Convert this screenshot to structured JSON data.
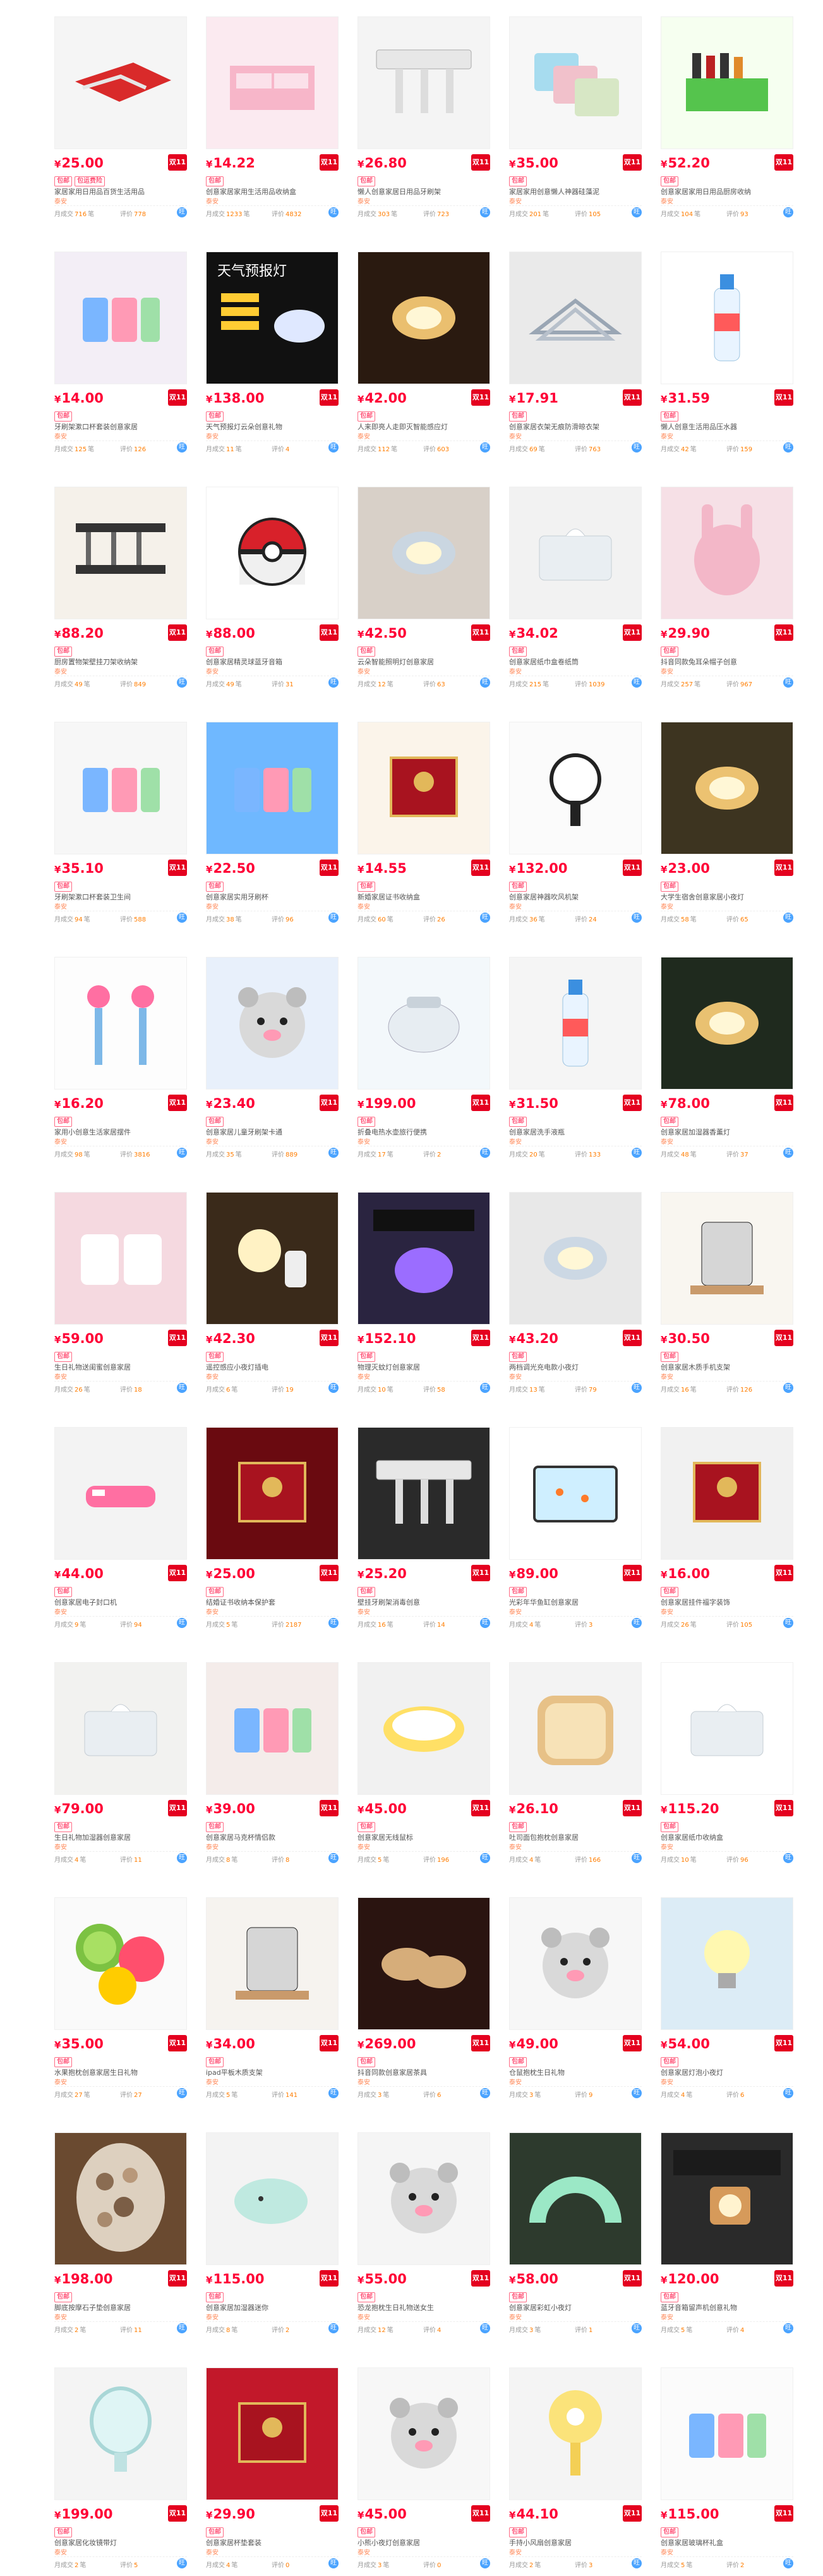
{
  "labels": {
    "sales_prefix": "月成交",
    "sales_unit": "笔",
    "reviews_prefix": "评价",
    "double11": "双11",
    "wangwang": "旺"
  },
  "colors": {
    "price": "#ff0036",
    "tag": "#ff0036",
    "badge": "#e4001f"
  },
  "products": [
    {
      "price": "25.00",
      "tags": [
        "包邮",
        "包运费险"
      ],
      "title": "家居家用日用品百货生活用品",
      "shop": "泰安",
      "sales": "716",
      "reviews": "778",
      "bg": "#f5f5f5",
      "art": "slicer"
    },
    {
      "price": "14.22",
      "tags": [
        "包邮"
      ],
      "title": "创意家居家用生活用品收纳盒",
      "shop": "泰安",
      "sales": "1233",
      "reviews": "4832",
      "bg": "#fbeaf0",
      "art": "organizer"
    },
    {
      "price": "26.80",
      "tags": [
        "包邮"
      ],
      "title": "懒人创意家居日用品牙刷架",
      "shop": "泰安",
      "sales": "303",
      "reviews": "723",
      "bg": "#f4f4f4",
      "art": "toothbrush"
    },
    {
      "price": "35.00",
      "tags": [
        "包邮"
      ],
      "title": "家居家用创意懒人神器硅藻泥",
      "shop": "泰安",
      "sales": "201",
      "reviews": "105",
      "bg": "#f7f7f7",
      "art": "mat"
    },
    {
      "price": "52.20",
      "tags": [
        "包邮"
      ],
      "title": "创意家居家用日用品厨房收纳",
      "shop": "泰安",
      "sales": "104",
      "reviews": "93",
      "bg": "#f6fff0",
      "art": "spicebox"
    },
    {
      "price": "14.00",
      "tags": [
        "包邮"
      ],
      "title": "牙刷架漱口杯套装创意家居",
      "shop": "泰安",
      "sales": "125",
      "reviews": "126",
      "bg": "#f3eef6",
      "art": "cups"
    },
    {
      "price": "138.00",
      "tags": [
        "包邮"
      ],
      "title": "天气预报灯云朵创意礼物",
      "shop": "泰安",
      "sales": "11",
      "reviews": "4",
      "bg": "#111111",
      "art": "weatherlamp"
    },
    {
      "price": "42.00",
      "tags": [
        "包邮"
      ],
      "title": "人来即亮人走即灭智能感应灯",
      "shop": "泰安",
      "sales": "112",
      "reviews": "603",
      "bg": "#2a1a10",
      "art": "sensorlamp"
    },
    {
      "price": "17.91",
      "tags": [
        "包邮"
      ],
      "title": "创意家居衣架无痕防滑晾衣架",
      "shop": "泰安",
      "sales": "69",
      "reviews": "763",
      "bg": "#eaeaea",
      "art": "hangers"
    },
    {
      "price": "31.59",
      "tags": [
        "包邮"
      ],
      "title": "懒人创意生活用品压水器",
      "shop": "泰安",
      "sales": "42",
      "reviews": "159",
      "bg": "#ffffff",
      "art": "bottle"
    },
    {
      "price": "88.20",
      "tags": [
        "包邮"
      ],
      "title": "厨房置物架壁挂刀架收纳架",
      "shop": "泰安",
      "sales": "49",
      "reviews": "849",
      "bg": "#f5f1ea",
      "art": "rack"
    },
    {
      "price": "88.00",
      "tags": [
        "包邮"
      ],
      "title": "创意家居精灵球蓝牙音箱",
      "shop": "泰安",
      "sales": "49",
      "reviews": "31",
      "bg": "#ffffff",
      "art": "pokeball"
    },
    {
      "price": "42.50",
      "tags": [
        "包邮"
      ],
      "title": "云朵智能照明灯创意家居",
      "shop": "泰安",
      "sales": "12",
      "reviews": "63",
      "bg": "#d8d0c8",
      "art": "cloudlamp"
    },
    {
      "price": "34.02",
      "tags": [
        "包邮"
      ],
      "title": "创意家居纸巾盒卷纸筒",
      "shop": "泰安",
      "sales": "215",
      "reviews": "1039",
      "bg": "#f2f2f2",
      "art": "tissue"
    },
    {
      "price": "29.90",
      "tags": [
        "包邮"
      ],
      "title": "抖音同款兔耳朵帽子创意",
      "shop": "泰安",
      "sales": "257",
      "reviews": "967",
      "bg": "#f6e0e6",
      "art": "hat"
    },
    {
      "price": "35.10",
      "tags": [
        "包邮"
      ],
      "title": "牙刷架漱口杯套装卫生间",
      "shop": "泰安",
      "sales": "94",
      "reviews": "588",
      "bg": "#f7f7f7",
      "art": "cups2"
    },
    {
      "price": "22.50",
      "tags": [
        "包邮"
      ],
      "title": "创意家居实用牙刷杯",
      "shop": "泰安",
      "sales": "38",
      "reviews": "96",
      "bg": "#6fb8ff",
      "art": "cups3"
    },
    {
      "price": "14.55",
      "tags": [
        "包邮"
      ],
      "title": "新婚家居证书收纳盒",
      "shop": "泰安",
      "sales": "60",
      "reviews": "26",
      "bg": "#fbf4ea",
      "art": "redbox"
    },
    {
      "price": "132.00",
      "tags": [
        "包邮"
      ],
      "title": "创意家居神器吹风机架",
      "shop": "泰安",
      "sales": "36",
      "reviews": "24",
      "bg": "#fbfbfb",
      "art": "dryer"
    },
    {
      "price": "23.00",
      "tags": [
        "包邮"
      ],
      "title": "大学生宿舍创意家居小夜灯",
      "shop": "泰安",
      "sales": "58",
      "reviews": "65",
      "bg": "#3d3420",
      "art": "nightlamp"
    },
    {
      "price": "16.20",
      "tags": [
        "包邮"
      ],
      "title": "家用小创意生活家居摆件",
      "shop": "泰安",
      "sales": "98",
      "reviews": "3816",
      "bg": "#fdfdfd",
      "art": "vases"
    },
    {
      "price": "23.40",
      "tags": [
        "包邮"
      ],
      "title": "创意家居儿童牙刷架卡通",
      "shop": "泰安",
      "sales": "35",
      "reviews": "889",
      "bg": "#e8f0fb",
      "art": "kids"
    },
    {
      "price": "199.00",
      "tags": [
        "包邮"
      ],
      "title": "折叠电热水壶旅行便携",
      "shop": "泰安",
      "sales": "17",
      "reviews": "2",
      "bg": "#f3f8fb",
      "art": "kettle"
    },
    {
      "price": "31.50",
      "tags": [
        "包邮"
      ],
      "title": "创意家居洗手液瓶",
      "shop": "泰安",
      "sales": "20",
      "reviews": "133",
      "bg": "#f5f5f5",
      "art": "bottle2"
    },
    {
      "price": "78.00",
      "tags": [
        "包邮"
      ],
      "title": "创意家居加湿器香薰灯",
      "shop": "泰安",
      "sales": "48",
      "reviews": "37",
      "bg": "#1f2a1e",
      "art": "humid"
    },
    {
      "price": "59.00",
      "tags": [
        "包邮"
      ],
      "title": "生日礼物送闺蜜创意家居",
      "shop": "泰安",
      "sales": "26",
      "reviews": "18",
      "bg": "#f5d9e0",
      "art": "cushion"
    },
    {
      "price": "42.30",
      "tags": [
        "包邮"
      ],
      "title": "遥控感应小夜灯插电",
      "shop": "泰安",
      "sales": "6",
      "reviews": "19",
      "bg": "#3a2a1a",
      "art": "remote"
    },
    {
      "price": "152.10",
      "tags": [
        "包邮"
      ],
      "title": "物理灭蚊灯创意家居",
      "shop": "泰安",
      "sales": "10",
      "reviews": "58",
      "bg": "#2a2440",
      "art": "mosquito"
    },
    {
      "price": "43.20",
      "tags": [
        "包邮"
      ],
      "title": "两档调光充电款小夜灯",
      "shop": "泰安",
      "sales": "13",
      "reviews": "79",
      "bg": "#e8e8e8",
      "art": "usblight"
    },
    {
      "price": "30.50",
      "tags": [
        "包邮"
      ],
      "title": "创意家居木质手机支架",
      "shop": "泰安",
      "sales": "16",
      "reviews": "126",
      "bg": "#f9f6f0",
      "art": "phonestand"
    },
    {
      "price": "44.00",
      "tags": [
        "包邮"
      ],
      "title": "创意家居电子封口机",
      "shop": "泰安",
      "sales": "9",
      "reviews": "94",
      "bg": "#f3f3f3",
      "art": "sealer"
    },
    {
      "price": "25.00",
      "tags": [
        "包邮"
      ],
      "title": "结婚证书收纳本保护套",
      "shop": "泰安",
      "sales": "5",
      "reviews": "2187",
      "bg": "#6a0a10",
      "art": "certificate"
    },
    {
      "price": "25.20",
      "tags": [
        "包邮"
      ],
      "title": "壁挂牙刷架消毒创意",
      "shop": "泰安",
      "sales": "16",
      "reviews": "14",
      "bg": "#2a2a2a",
      "art": "hook"
    },
    {
      "price": "89.00",
      "tags": [
        "包邮"
      ],
      "title": "光彩年华鱼缸创意家居",
      "shop": "泰安",
      "sales": "4",
      "reviews": "3",
      "bg": "#ffffff",
      "art": "fishtank"
    },
    {
      "price": "16.00",
      "tags": [
        "包邮"
      ],
      "title": "创意家居挂件福字装饰",
      "shop": "泰安",
      "sales": "26",
      "reviews": "105",
      "bg": "#f1f1f1",
      "art": "redwall"
    },
    {
      "price": "79.00",
      "tags": [
        "包邮"
      ],
      "title": "生日礼物加湿器创意家居",
      "shop": "泰安",
      "sales": "4",
      "reviews": "11",
      "bg": "#f2f2f0",
      "art": "diffuser"
    },
    {
      "price": "39.00",
      "tags": [
        "包邮"
      ],
      "title": "创意家居马克杯情侣款",
      "shop": "泰安",
      "sales": "8",
      "reviews": "8",
      "bg": "#f4ecea",
      "art": "mugs"
    },
    {
      "price": "45.00",
      "tags": [
        "包邮"
      ],
      "title": "创意家居无线鼠标",
      "shop": "泰安",
      "sales": "5",
      "reviews": "196",
      "bg": "#f1f1f1",
      "art": "mouse"
    },
    {
      "price": "26.10",
      "tags": [
        "包邮"
      ],
      "title": "吐司面包抱枕创意家居",
      "shop": "泰安",
      "sales": "4",
      "reviews": "166",
      "bg": "#f3f3f3",
      "art": "toast"
    },
    {
      "price": "115.20",
      "tags": [
        "包邮"
      ],
      "title": "创意家居纸巾收纳盒",
      "shop": "泰安",
      "sales": "10",
      "reviews": "96",
      "bg": "#ffffff",
      "art": "bluebox"
    },
    {
      "price": "35.00",
      "tags": [
        "包邮"
      ],
      "title": "水果抱枕创意家居生日礼物",
      "shop": "泰安",
      "sales": "27",
      "reviews": "27",
      "bg": "#fafafa",
      "art": "fruits"
    },
    {
      "price": "34.00",
      "tags": [
        "包邮"
      ],
      "title": "ipad平板木质支架",
      "shop": "泰安",
      "sales": "5",
      "reviews": "141",
      "bg": "#f6f3ef",
      "art": "ipadstand"
    },
    {
      "price": "269.00",
      "tags": [
        "包邮"
      ],
      "title": "抖音同款创意家居茶具",
      "shop": "泰安",
      "sales": "3",
      "reviews": "6",
      "bg": "#2a1410",
      "art": "teacups"
    },
    {
      "price": "49.00",
      "tags": [
        "包邮"
      ],
      "title": "仓鼠抱枕生日礼物",
      "shop": "泰安",
      "sales": "3",
      "reviews": "9",
      "bg": "#f7f7f7",
      "art": "hamster"
    },
    {
      "price": "54.00",
      "tags": [
        "包邮"
      ],
      "title": "创意家居灯泡小夜灯",
      "shop": "泰安",
      "sales": "4",
      "reviews": "6",
      "bg": "#dcecf6",
      "art": "bulb"
    },
    {
      "price": "198.00",
      "tags": [
        "包邮"
      ],
      "title": "脚底按摩石子垫创意家居",
      "shop": "泰安",
      "sales": "2",
      "reviews": "11",
      "bg": "#6a4a30",
      "art": "pebbles"
    },
    {
      "price": "115.00",
      "tags": [
        "包邮"
      ],
      "title": "创意家居加湿器迷你",
      "shop": "泰安",
      "sales": "8",
      "reviews": "2",
      "bg": "#f3f3f3",
      "art": "whale"
    },
    {
      "price": "55.00",
      "tags": [
        "包邮"
      ],
      "title": "恐龙抱枕生日礼物送女生",
      "shop": "泰安",
      "sales": "12",
      "reviews": "4",
      "bg": "#f5f5f5",
      "art": "dino"
    },
    {
      "price": "58.00",
      "tags": [
        "包邮"
      ],
      "title": "创意家居彩虹小夜灯",
      "shop": "泰安",
      "sales": "3",
      "reviews": "1",
      "bg": "#2d3a2d",
      "art": "rainbow"
    },
    {
      "price": "120.00",
      "tags": [
        "包邮"
      ],
      "title": "蓝牙音箱留声机创意礼物",
      "shop": "泰安",
      "sales": "5",
      "reviews": "4",
      "bg": "#2a2a2a",
      "art": "speaker"
    },
    {
      "price": "199.00",
      "tags": [
        "包邮"
      ],
      "title": "创意家居化妆镜带灯",
      "shop": "泰安",
      "sales": "2",
      "reviews": "5",
      "bg": "#f4f4f4",
      "art": "mirror"
    },
    {
      "price": "29.90",
      "tags": [
        "包邮"
      ],
      "title": "创意家居杯垫套装",
      "shop": "泰安",
      "sales": "4",
      "reviews": "0",
      "bg": "#c2182a",
      "art": "coasters"
    },
    {
      "price": "45.00",
      "tags": [
        "包邮"
      ],
      "title": "小熊小夜灯创意家居",
      "shop": "泰安",
      "sales": "3",
      "reviews": "0",
      "bg": "#f7f7f7",
      "art": "bear"
    },
    {
      "price": "44.10",
      "tags": [
        "包邮"
      ],
      "title": "手持小风扇创意家居",
      "shop": "泰安",
      "sales": "2",
      "reviews": "3",
      "bg": "#f4f4f4",
      "art": "fan"
    },
    {
      "price": "115.00",
      "tags": [
        "包邮"
      ],
      "title": "创意家居玻璃杯礼盒",
      "shop": "泰安",
      "sales": "5",
      "reviews": "2",
      "bg": "#fbfbfb",
      "art": "glass"
    }
  ]
}
